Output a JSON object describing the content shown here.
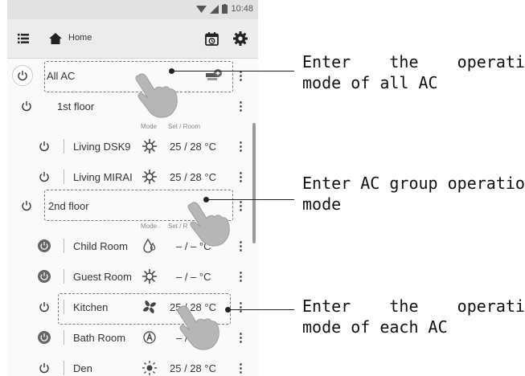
{
  "status_bar": {
    "time": "10:48",
    "icons": [
      "wifi-icon",
      "signal-icon",
      "battery-icon"
    ]
  },
  "appbar": {
    "title": "Home",
    "icons": [
      "menu-icon",
      "home-icon",
      "schedule-icon",
      "settings-icon"
    ]
  },
  "list": {
    "header_hint": {
      "mode": "Mode",
      "set_room": "Set / Room"
    },
    "header_hint_2": {
      "mode": "Mode",
      "set_room": "Set / R"
    },
    "rows": [
      {
        "label": "All AC",
        "power": "off",
        "mode_icon": "group-ac-icon",
        "temp": ""
      },
      {
        "label": "1st floor",
        "power": "off",
        "mode_icon": "",
        "temp": ""
      },
      {
        "label": "Living DSK9",
        "power": "off",
        "mode_icon": "heat-icon",
        "temp": "25 / 28 °C"
      },
      {
        "label": "Living MIRAI",
        "power": "off",
        "mode_icon": "heat-icon",
        "temp": "25 / 28 °C"
      },
      {
        "label": "2nd floor",
        "power": "off",
        "mode_icon": "",
        "temp": ""
      },
      {
        "label": "Child Room",
        "power": "on",
        "mode_icon": "dry-icon",
        "temp": "– / –  °C"
      },
      {
        "label": "Guest Room",
        "power": "on",
        "mode_icon": "heat-icon",
        "temp": "– / –  °C"
      },
      {
        "label": "Kitchen",
        "power": "off",
        "mode_icon": "fan-icon",
        "temp": "25 / 28 °C"
      },
      {
        "label": "Bath Room",
        "power": "on",
        "mode_icon": "auto-icon",
        "temp": "– / –  °C"
      },
      {
        "label": "Den",
        "power": "off",
        "mode_icon": "sun-icon",
        "temp": "25 / 28 °C"
      }
    ]
  },
  "annotations": [
    {
      "line1": "Enter    the    operating",
      "line2": "mode of all AC"
    },
    {
      "line1": "Enter AC group operation",
      "line2": "mode"
    },
    {
      "line1": "Enter    the    operating",
      "line2": "mode of each AC"
    }
  ]
}
